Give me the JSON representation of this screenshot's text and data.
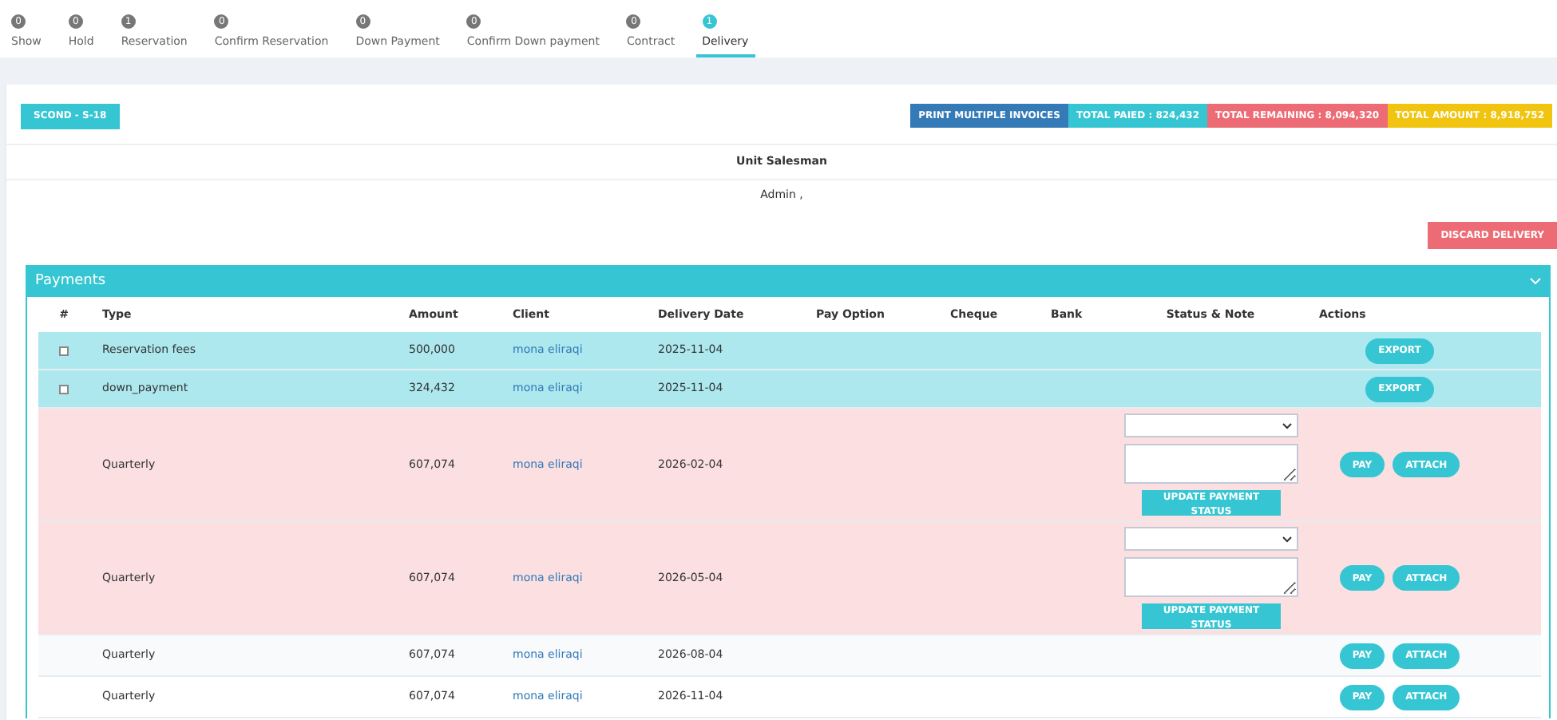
{
  "tabs": [
    {
      "count": "0",
      "label": "Show",
      "selected": false
    },
    {
      "count": "0",
      "label": "Hold",
      "selected": false
    },
    {
      "count": "1",
      "label": "Reservation",
      "selected": false
    },
    {
      "count": "0",
      "label": "Confirm Reservation",
      "selected": false
    },
    {
      "count": "0",
      "label": "Down Payment",
      "selected": false
    },
    {
      "count": "0",
      "label": "Confirm Down payment",
      "selected": false
    },
    {
      "count": "0",
      "label": "Contract",
      "selected": false
    },
    {
      "count": "1",
      "label": "Delivery",
      "selected": true
    }
  ],
  "unit_badge": "SCOND - S-18",
  "summary_buttons": [
    {
      "label": "PRINT MULTIPLE INVOICES",
      "color": "#337ab7"
    },
    {
      "label": "TOTAL PAIED : 824,432",
      "color": "#36c6d3"
    },
    {
      "label": "TOTAL REMAINING : 8,094,320",
      "color": "#ed6b75"
    },
    {
      "label": "TOTAL AMOUNT : 8,918,752",
      "color": "#f1c40f"
    }
  ],
  "salesman": {
    "heading": "Unit Salesman",
    "value": "Admin ,"
  },
  "discard_button": "DISCARD DELIVERY",
  "payments": {
    "title": "Payments",
    "expanded": true,
    "columns": [
      "#",
      "Type",
      "Amount",
      "Client",
      "Delivery Date",
      "Pay Option",
      "Cheque",
      "Bank",
      "Status & Note",
      "Actions"
    ],
    "rows": [
      {
        "kind": "paid",
        "checked": false,
        "type": "Reservation fees",
        "amount": "500,000",
        "client": "mona eliraqi",
        "date": "2025-11-04",
        "actions": [
          "EXPORT"
        ]
      },
      {
        "kind": "paid",
        "checked": false,
        "type": "down_payment",
        "amount": "324,432",
        "client": "mona eliraqi",
        "date": "2025-11-04",
        "actions": [
          "EXPORT"
        ]
      },
      {
        "kind": "overdue",
        "type": "Quarterly",
        "amount": "607,074",
        "client": "mona eliraqi",
        "date": "2026-02-04",
        "status_button": "UPDATE PAYMENT STATUS",
        "actions": [
          "PAY",
          "ATTACH"
        ]
      },
      {
        "kind": "overdue",
        "type": "Quarterly",
        "amount": "607,074",
        "client": "mona eliraqi",
        "date": "2026-05-04",
        "status_button": "UPDATE PAYMENT STATUS",
        "actions": [
          "PAY",
          "ATTACH"
        ]
      },
      {
        "kind": "pending",
        "type": "Quarterly",
        "amount": "607,074",
        "client": "mona eliraqi",
        "date": "2026-08-04",
        "actions": [
          "PAY",
          "ATTACH"
        ]
      },
      {
        "kind": "pending",
        "type": "Quarterly",
        "amount": "607,074",
        "client": "mona eliraqi",
        "date": "2026-11-04",
        "actions": [
          "PAY",
          "ATTACH"
        ]
      }
    ]
  }
}
